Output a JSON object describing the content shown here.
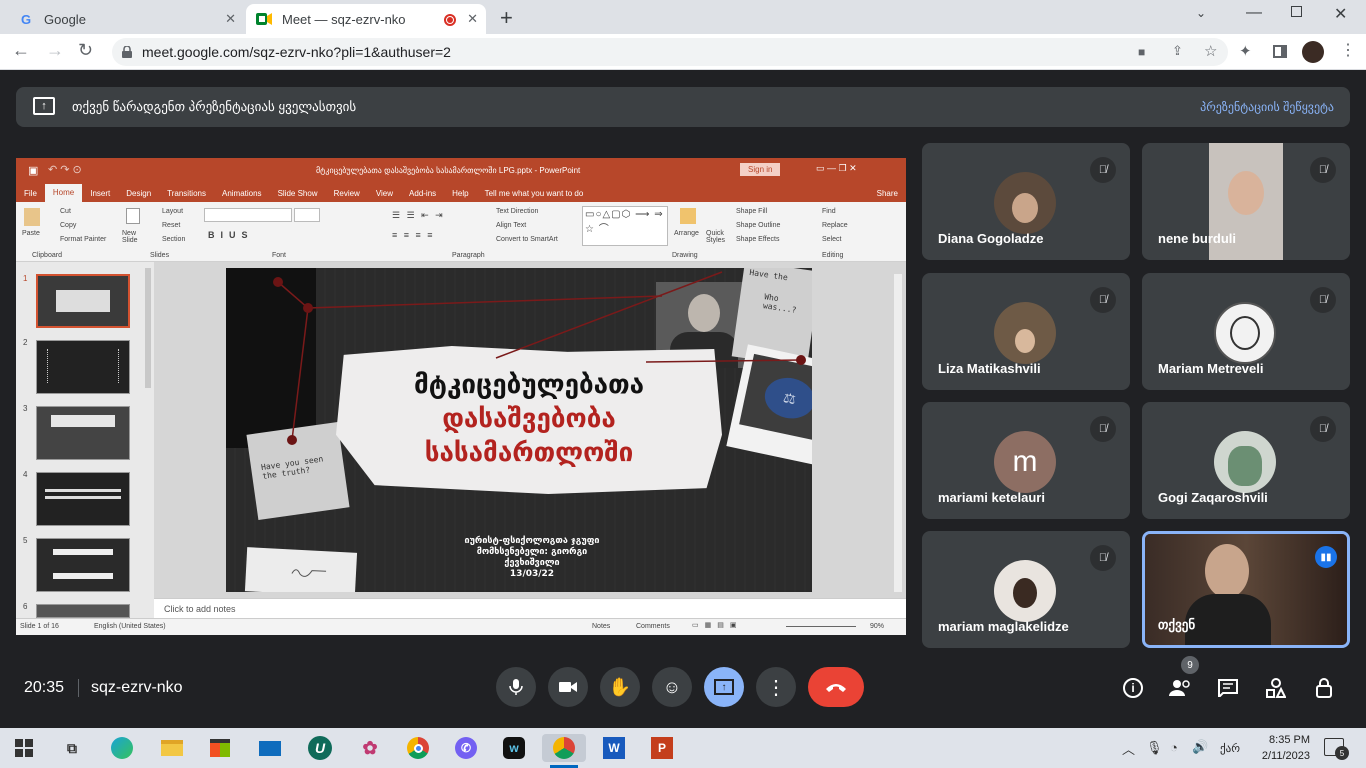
{
  "browser": {
    "tabs": [
      {
        "title": "Google",
        "close": "✕"
      },
      {
        "title": "Meet — sqz-ezrv-nko",
        "close": "✕"
      }
    ],
    "new_tab": "+",
    "url": "meet.google.com/sqz-ezrv-nko?pli=1&authuser=2"
  },
  "banner": {
    "message": "თქვენ წარადგენთ პრეზენტაციას ყველასთვის",
    "stop_label": "პრეზენტაციის შეწყვეტა"
  },
  "powerpoint": {
    "title": "მტკიცებულებათა დასაშვებობა სასამართლოში LPG.pptx - PowerPoint",
    "sign_in": "Sign in",
    "share": "Share",
    "menu": [
      "File",
      "Home",
      "Insert",
      "Design",
      "Transitions",
      "Animations",
      "Slide Show",
      "Review",
      "View",
      "Add-ins",
      "Help"
    ],
    "tell_me": "Tell me what you want to do",
    "ribbon": {
      "clipboard": {
        "paste": "Paste",
        "cut": "Cut",
        "copy": "Copy",
        "format_painter": "Format Painter",
        "group": "Clipboard"
      },
      "slides": {
        "new_slide": "New Slide",
        "layout": "Layout",
        "reset": "Reset",
        "section": "Section",
        "group": "Slides"
      },
      "font_group": "Font",
      "paragraph": {
        "text_direction": "Text Direction",
        "align_text": "Align Text",
        "convert": "Convert to SmartArt",
        "group": "Paragraph"
      },
      "drawing": {
        "arrange": "Arrange",
        "quick_styles": "Quick Styles",
        "shape_fill": "Shape Fill",
        "shape_outline": "Shape Outline",
        "shape_effects": "Shape Effects",
        "group": "Drawing"
      },
      "editing": {
        "find": "Find",
        "replace": "Replace",
        "select": "Select",
        "group": "Editing"
      }
    },
    "thumb_numbers": [
      "1",
      "2",
      "3",
      "4",
      "5",
      "6"
    ],
    "slide": {
      "title_line1": "მტკიცებულებათა",
      "title_line2": "დასაშვებობა",
      "title_line3": "სასამართლოში",
      "note_left": "Have you seen the truth?",
      "note_right": "Have the",
      "note_right2": "Who was...?",
      "subtitle1": "იურისტ-ფსიქოლოგთა ჯგუფი",
      "subtitle2": "მომხსენებელი: გიორგი ქევხიშვილი",
      "date": "13/03/22"
    },
    "notes_placeholder": "Click to add notes",
    "status": {
      "slide": "Slide 1 of 16",
      "lang": "English (United States)",
      "notes": "Notes",
      "comments": "Comments",
      "zoom": "90%"
    }
  },
  "participants": [
    {
      "name": "Diana Gogoladze",
      "muted": true
    },
    {
      "name": "nene burduli",
      "muted": true
    },
    {
      "name": "Liza Matikashvili",
      "muted": true
    },
    {
      "name": "Mariam Metreveli",
      "muted": true
    },
    {
      "name": "mariami ketelauri",
      "muted": true,
      "initial": "m",
      "initial_color": "#8d6e63"
    },
    {
      "name": "Gogi Zaqaroshvili",
      "muted": true
    },
    {
      "name": "mariam maglakelidze",
      "muted": true
    },
    {
      "name": "თქვენ",
      "muted": false
    }
  ],
  "meeting": {
    "time": "20:35",
    "code": "sqz-ezrv-nko",
    "people_count": "9"
  },
  "taskbar": {
    "lang": "ქარ",
    "clock_time": "8:35 PM",
    "clock_date": "2/11/2023",
    "notif_count": "5"
  },
  "colors": {
    "accent": "#8ab4f8",
    "end_call": "#ea4335",
    "ppt": "#b7472a"
  }
}
